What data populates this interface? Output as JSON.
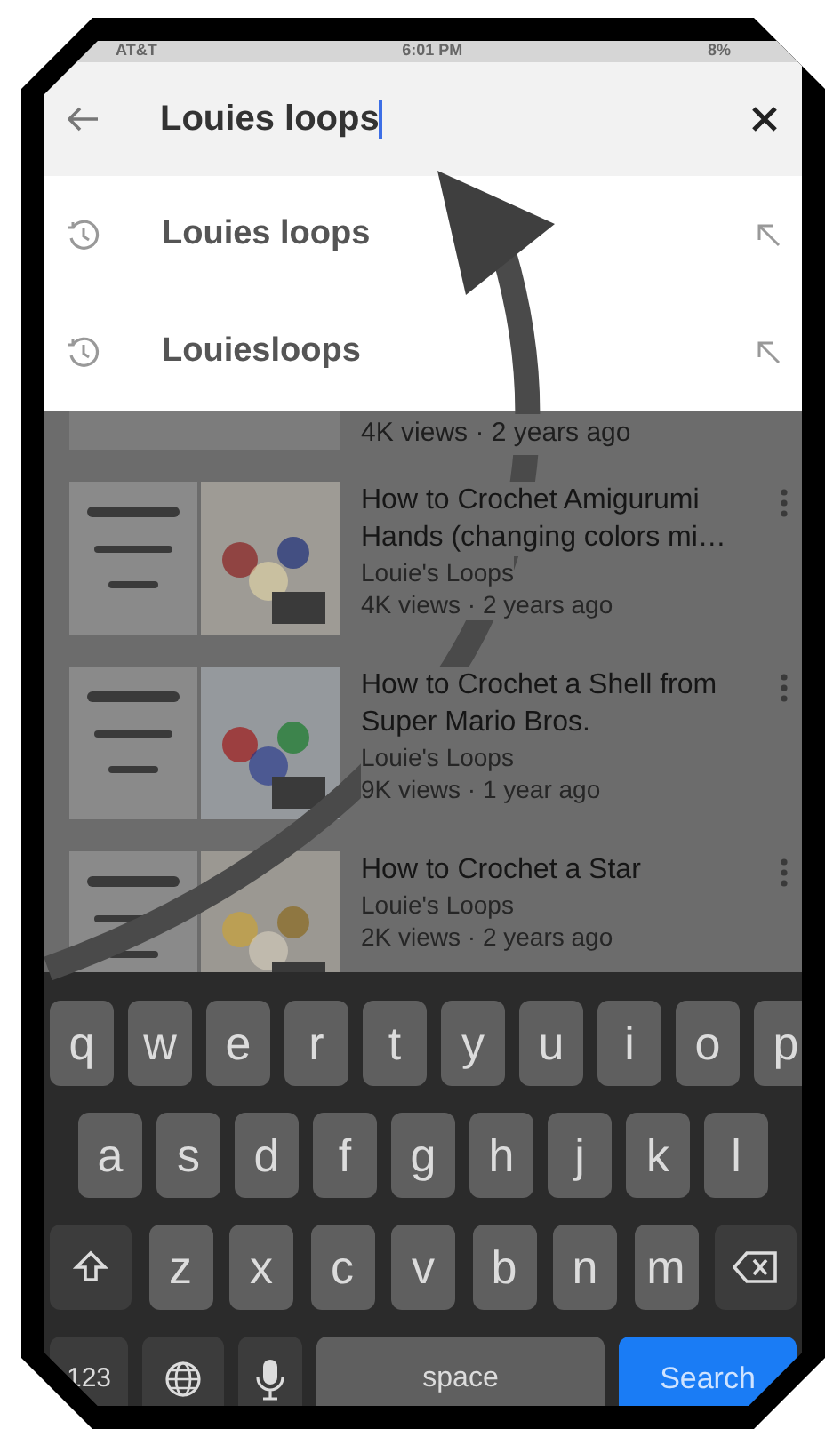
{
  "status_bar": {
    "carrier": "AT&T",
    "time": "6:01 PM",
    "battery": "8%"
  },
  "search": {
    "value": "Louies loops"
  },
  "suggestions": [
    {
      "text": "Louies loops"
    },
    {
      "text": "Louiesloops"
    }
  ],
  "results": [
    {
      "kind": "partial",
      "meta": "4K views · 2 years ago"
    },
    {
      "kind": "video",
      "title": "How to Crochet Amigurumi Hands (changing colors mi…",
      "channel": "Louie's Loops",
      "meta": "4K views · 2 years ago"
    },
    {
      "kind": "video",
      "title": "How to Crochet a Shell from Super Mario Bros.",
      "channel": "Louie's Loops",
      "meta": "9K views · 1 year ago"
    },
    {
      "kind": "video",
      "title": "How to Crochet a Star",
      "channel": "Louie's Loops",
      "meta": "2K views · 2 years ago"
    }
  ],
  "keyboard": {
    "row_1": [
      {
        "kind": "letter",
        "label": "q"
      },
      {
        "kind": "letter",
        "label": "w"
      },
      {
        "kind": "letter",
        "label": "e"
      },
      {
        "kind": "letter",
        "label": "r"
      },
      {
        "kind": "letter",
        "label": "t"
      },
      {
        "kind": "letter",
        "label": "y"
      },
      {
        "kind": "letter",
        "label": "u"
      },
      {
        "kind": "letter",
        "label": "i"
      },
      {
        "kind": "letter",
        "label": "o"
      },
      {
        "kind": "letter",
        "label": "p"
      }
    ],
    "row_2": [
      {
        "kind": "letter",
        "label": "a"
      },
      {
        "kind": "letter",
        "label": "s"
      },
      {
        "kind": "letter",
        "label": "d"
      },
      {
        "kind": "letter",
        "label": "f"
      },
      {
        "kind": "letter",
        "label": "g"
      },
      {
        "kind": "letter",
        "label": "h"
      },
      {
        "kind": "letter",
        "label": "j"
      },
      {
        "kind": "letter",
        "label": "k"
      },
      {
        "kind": "letter",
        "label": "l"
      }
    ],
    "row_3": [
      {
        "kind": "shift"
      },
      {
        "kind": "letter",
        "label": "z"
      },
      {
        "kind": "letter",
        "label": "x"
      },
      {
        "kind": "letter",
        "label": "c"
      },
      {
        "kind": "letter",
        "label": "v"
      },
      {
        "kind": "letter",
        "label": "b"
      },
      {
        "kind": "letter",
        "label": "n"
      },
      {
        "kind": "letter",
        "label": "m"
      },
      {
        "kind": "backspace"
      }
    ],
    "bottom_row": [
      {
        "kind": "numbers",
        "label": "123"
      },
      {
        "kind": "globe"
      },
      {
        "kind": "mic"
      },
      {
        "kind": "space",
        "label": "space"
      },
      {
        "kind": "search",
        "label": "Search"
      }
    ]
  }
}
